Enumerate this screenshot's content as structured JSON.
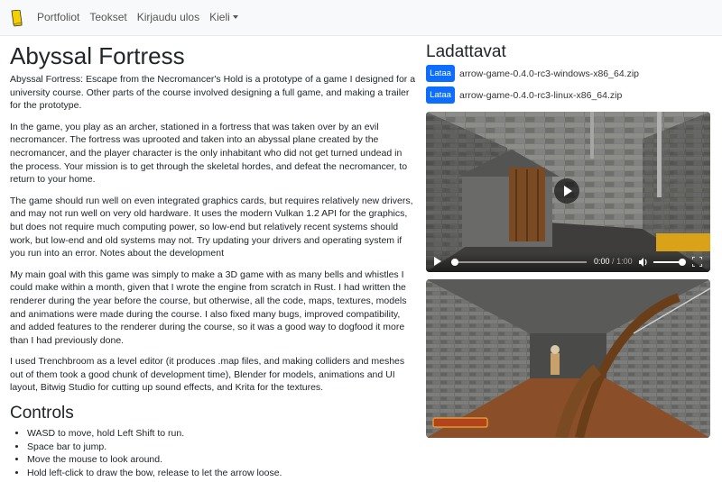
{
  "nav": {
    "items": [
      "Portfoliot",
      "Teokset",
      "Kirjaudu ulos"
    ],
    "language": "Kieli",
    "brand_icon": "book-icon"
  },
  "article": {
    "title": "Abyssal Fortress",
    "paragraphs": [
      "Abyssal Fortress: Escape from the Necromancer's Hold is a prototype of a game I designed for a university course. Other parts of the course involved designing a full game, and making a trailer for the prototype.",
      "In the game, you play as an archer, stationed in a fortress that was taken over by an evil necromancer. The fortress was uprooted and taken into an abyssal plane created by the necromancer, and the player character is the only inhabitant who did not get turned undead in the process. Your mission is to get through the skeletal hordes, and defeat the necromancer, to return to your home.",
      "The game should run well on even integrated graphics cards, but requires relatively new drivers, and may not run well on very old hardware. It uses the modern Vulkan 1.2 API for the graphics, but does not require much computing power, so low-end but relatively recent systems should work, but low-end and old systems may not. Try updating your drivers and operating system if you run into an error. Notes about the development",
      "My main goal with this game was simply to make a 3D game with as many bells and whistles I could make within a month, given that I wrote the engine from scratch in Rust. I had written the renderer during the year before the course, but otherwise, all the code, maps, textures, models and animations were made during the course. I also fixed many bugs, improved compatibility, and added features to the renderer during the course, so it was a good way to dogfood it more than I had previously done.",
      "I used Trenchbroom as a level editor (it produces .map files, and making colliders and meshes out of them took a good chunk of development time), Blender for models, animations and UI layout, Bitwig Studio for cutting up sound effects, and Krita for the textures."
    ],
    "controls_title": "Controls",
    "controls": [
      "WASD to move, hold Left Shift to run.",
      "Space bar to jump.",
      "Move the mouse to look around.",
      "Hold left-click to draw the bow, release to let the arrow loose."
    ]
  },
  "downloads": {
    "title": "Ladattavat",
    "button_label": "Lataa",
    "files": [
      "arrow-game-0.4.0-rc3-windows-x86_64.zip",
      "arrow-game-0.4.0-rc3-linux-x86_64.zip"
    ]
  },
  "video": {
    "current_time": "0:00",
    "duration": "1:00",
    "progress": 0,
    "volume": 1.0
  },
  "colors": {
    "primary": "#0d6efd",
    "brand": "#f5d000",
    "navbar_bg": "#f8f9fa"
  }
}
